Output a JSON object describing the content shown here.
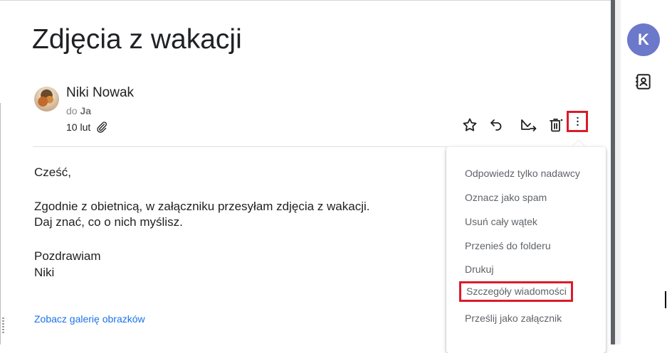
{
  "email": {
    "subject": "Zdjęcia z wakacji",
    "sender_name": "Niki Nowak",
    "to_prefix": "do",
    "to_name": "Ja",
    "date": "10 lut",
    "body": {
      "greeting": "Cześć,",
      "line1": "Zgodnie z obietnicą, w załączniku przesyłam zdjęcia z wakacji.",
      "line2": "Daj znać, co o nich myślisz.",
      "closing": "Pozdrawiam",
      "signature": "Niki"
    },
    "gallery_link": "Zobacz galerię obrazków"
  },
  "menu": {
    "items": [
      "Odpowiedz tylko nadawcy",
      "Oznacz jako spam",
      "Usuń cały wątek",
      "Przenieś do folderu",
      "Drukuj",
      "Szczegóły wiadomości",
      "Prześlij jako załącznik"
    ]
  },
  "sidebar": {
    "avatar_initial": "K"
  },
  "toolbar_icons": [
    "star-icon",
    "reply-icon",
    "move-icon",
    "delete-icon",
    "more-vert-icon"
  ],
  "colors": {
    "highlight": "#d91c2a",
    "link": "#1a73e8",
    "avatar_bg": "#6c78c9"
  }
}
